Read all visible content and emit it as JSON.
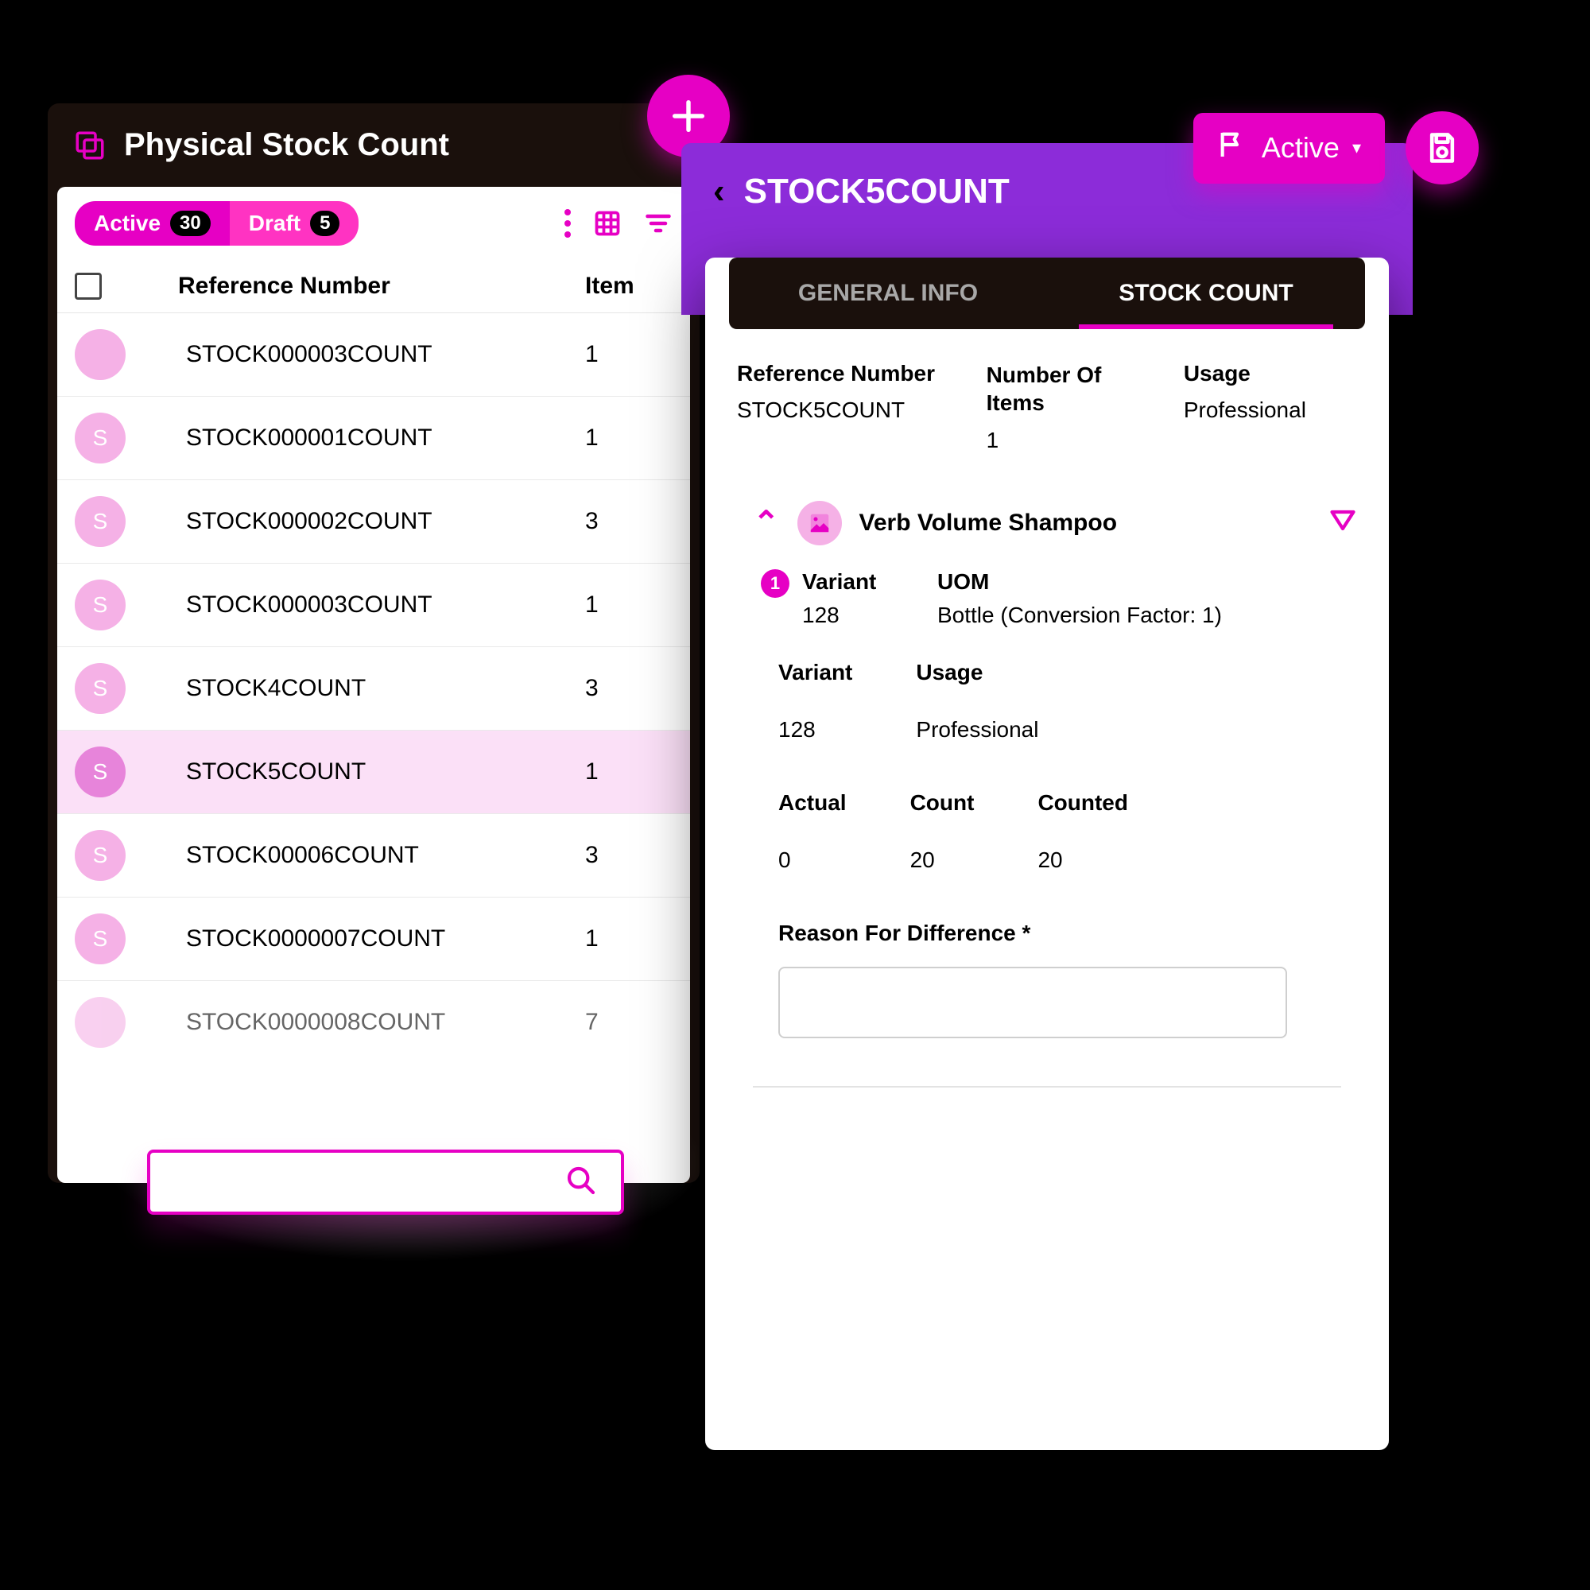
{
  "list": {
    "title": "Physical Stock Count",
    "status_active_label": "Active",
    "status_active_count": "30",
    "status_draft_label": "Draft",
    "status_draft_count": "5",
    "headers": {
      "reference": "Reference Number",
      "item": "Item"
    },
    "rows": [
      {
        "avatar": "",
        "ref": "STOCK000003COUNT",
        "item": "1",
        "selected": false
      },
      {
        "avatar": "S",
        "ref": "STOCK000001COUNT",
        "item": "1",
        "selected": false
      },
      {
        "avatar": "S",
        "ref": "STOCK000002COUNT",
        "item": "3",
        "selected": false
      },
      {
        "avatar": "S",
        "ref": "STOCK000003COUNT",
        "item": "1",
        "selected": false
      },
      {
        "avatar": "S",
        "ref": "STOCK4COUNT",
        "item": "3",
        "selected": false
      },
      {
        "avatar": "S",
        "ref": "STOCK5COUNT",
        "item": "1",
        "selected": true
      },
      {
        "avatar": "S",
        "ref": "STOCK00006COUNT",
        "item": "3",
        "selected": false
      },
      {
        "avatar": "S",
        "ref": "STOCK0000007COUNT",
        "item": "1",
        "selected": false
      },
      {
        "avatar": "",
        "ref": "STOCK0000008COUNT",
        "item": "7",
        "selected": false
      }
    ]
  },
  "top_right": {
    "active_label": "Active"
  },
  "detail": {
    "title": "STOCK5COUNT",
    "tabs": {
      "general": "GENERAL INFO",
      "stock": "STOCK COUNT"
    },
    "info": {
      "ref_label": "Reference Number",
      "ref_value": "STOCK5COUNT",
      "num_label": "Number Of Items",
      "num_value": "1",
      "usage_label": "Usage",
      "usage_value": "Professional"
    },
    "product": {
      "name": "Verb Volume Shampoo",
      "index": "1",
      "variant_label": "Variant",
      "variant_value": "128",
      "uom_label": "UOM",
      "uom_value": "Bottle (Conversion Factor: 1)",
      "usage_label": "Usage",
      "usage_value": "Professional",
      "variant2_label": "Variant",
      "variant2_value": "128",
      "actual_label": "Actual",
      "actual_value": "0",
      "count_label": "Count",
      "count_value": "20",
      "counted_label": "Counted",
      "counted_value": "20",
      "reason_label": "Reason For Difference *"
    }
  }
}
